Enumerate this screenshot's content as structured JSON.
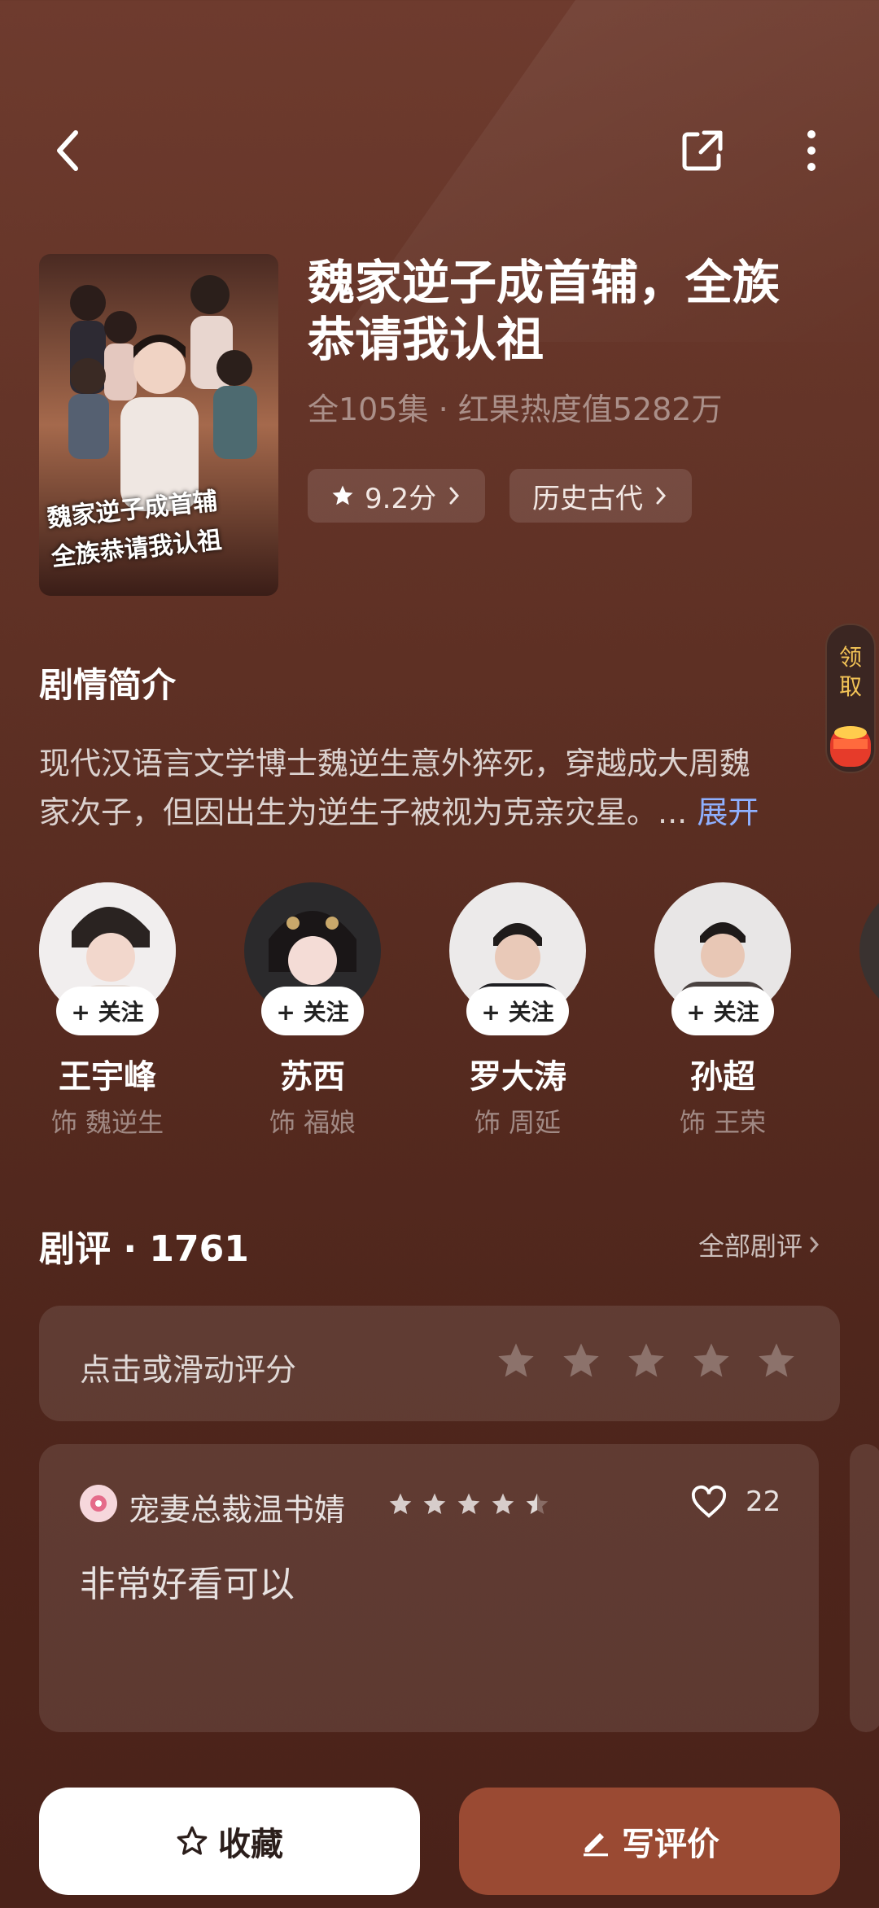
{
  "header": {
    "back_icon": "chevron-left-icon",
    "share_icon": "share-icon",
    "more_icon": "more-vertical-icon"
  },
  "show": {
    "title_line1": "魏家逆子成首辅，全族",
    "title_line2": "恭请我认祖",
    "meta": "全105集 · 红果热度值5282万",
    "rating_chip": "9.2分",
    "genre_chip": "历史古代",
    "cover_text_line1": "魏家逆子成首辅",
    "cover_text_line2": "全族恭请我认祖"
  },
  "synopsis": {
    "heading": "剧情简介",
    "line1": "现代汉语言文学博士魏逆生意外猝死，穿越成大周魏",
    "line2": "家次子，但因出生为逆生子被视为克亲灾星。...",
    "expand": "展开"
  },
  "reward_float": {
    "label_line1": "领",
    "label_line2": "取"
  },
  "cast": [
    {
      "name": "王宇峰",
      "role": "饰 魏逆生",
      "follow": "+ 关注"
    },
    {
      "name": "苏西",
      "role": "饰 福娘",
      "follow": "+ 关注"
    },
    {
      "name": "罗大涛",
      "role": "饰 周延",
      "follow": "+ 关注"
    },
    {
      "name": "孙超",
      "role": "饰 王荣",
      "follow": "+ 关注"
    }
  ],
  "reviews": {
    "heading": "剧评 · 1761",
    "all_link": "全部剧评",
    "rate_prompt": "点击或滑动评分",
    "items": [
      {
        "user": "宠妻总裁温书婧",
        "stars": 4.5,
        "likes": "22",
        "text": "非常好看可以"
      }
    ]
  },
  "actions": {
    "collect": "收藏",
    "write_review": "写评价"
  },
  "colors": {
    "accent_button": "#9a4a33",
    "link": "#8fb0ff",
    "star_gold": "#f3c356"
  }
}
